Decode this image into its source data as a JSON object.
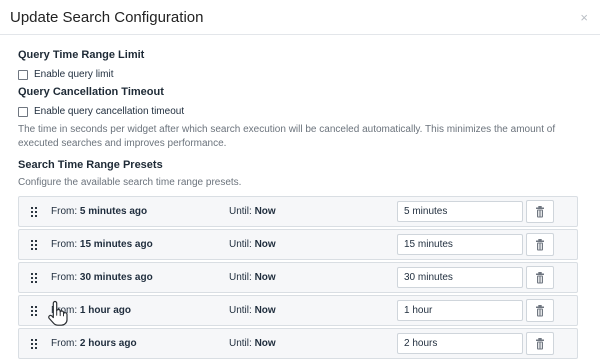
{
  "dialog": {
    "title": "Update Search Configuration",
    "close_icon": "×"
  },
  "sections": {
    "query_time_range_limit": {
      "title": "Query Time Range Limit",
      "checkbox_label": "Enable query limit",
      "checked": false
    },
    "query_cancellation_timeout": {
      "title": "Query Cancellation Timeout",
      "checkbox_label": "Enable query cancellation timeout",
      "checked": false,
      "help_text": "The time in seconds per widget after which search execution will be canceled automatically. This minimizes the amount of executed searches and improves performance."
    },
    "search_time_range_presets": {
      "title": "Search Time Range Presets",
      "subtitle": "Configure the available search time range presets."
    }
  },
  "presets": [
    {
      "from_label": "From:",
      "from_value": "5 minutes ago",
      "until_label": "Until:",
      "until_value": "Now",
      "input_value": "5 minutes"
    },
    {
      "from_label": "From:",
      "from_value": "15 minutes ago",
      "until_label": "Until:",
      "until_value": "Now",
      "input_value": "15 minutes"
    },
    {
      "from_label": "From:",
      "from_value": "30 minutes ago",
      "until_label": "Until:",
      "until_value": "Now",
      "input_value": "30 minutes"
    },
    {
      "from_label": "From:",
      "from_value": "1 hour ago",
      "until_label": "Until:",
      "until_value": "Now",
      "input_value": "1 hour"
    },
    {
      "from_label": "From:",
      "from_value": "2 hours ago",
      "until_label": "Until:",
      "until_value": "Now",
      "input_value": "2 hours"
    }
  ],
  "icons": {
    "drag": "drag-handle-icon",
    "delete": "trash-icon",
    "cursor": "hand-pointer-icon"
  }
}
